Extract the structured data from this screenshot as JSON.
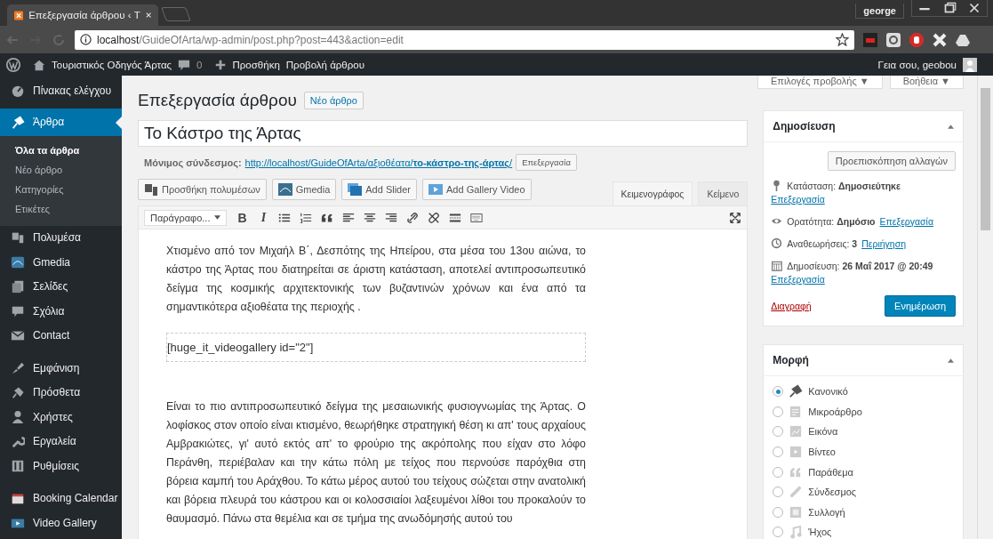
{
  "browser": {
    "tab_title": "Επεξεργασία άρθρου ‹ T",
    "profile": "george",
    "url_host": "localhost",
    "url_path": "/GuideOfArta/wp-admin/post.php?post=443&action=edit"
  },
  "admin_bar": {
    "site_name": "Τουριστικός Οδηγός Άρτας",
    "comments": "0",
    "new": "Προσθήκη",
    "view": "Προβολή άρθρου",
    "greeting": "Γεια σου, geobou"
  },
  "sidebar": {
    "groups": [
      {
        "items": [
          {
            "label": "Πίνακας ελέγχου",
            "selected": false
          },
          {
            "label": "Άρθρα",
            "selected": true,
            "children": [
              {
                "label": "Όλα τα άρθρα",
                "selected": true
              },
              {
                "label": "Νέο άρθρο",
                "selected": false
              },
              {
                "label": "Κατηγορίες",
                "selected": false
              },
              {
                "label": "Ετικέτες",
                "selected": false
              }
            ]
          },
          {
            "label": "Πολυμέσα",
            "selected": false
          },
          {
            "label": "Gmedia",
            "selected": false
          },
          {
            "label": "Σελίδες",
            "selected": false
          },
          {
            "label": "Σχόλια",
            "selected": false
          },
          {
            "label": "Contact",
            "selected": false
          }
        ]
      },
      {
        "items": [
          {
            "label": "Εμφάνιση",
            "selected": false
          },
          {
            "label": "Πρόσθετα",
            "selected": false
          },
          {
            "label": "Χρήστες",
            "selected": false
          },
          {
            "label": "Εργαλεία",
            "selected": false
          },
          {
            "label": "Ρυθμίσεις",
            "selected": false
          }
        ]
      },
      {
        "items": [
          {
            "label": "Booking Calendar",
            "selected": false
          },
          {
            "label": "Video Gallery",
            "selected": false
          }
        ]
      }
    ]
  },
  "screen_tabs": [
    "Επιλογές προβολής ▼",
    "Βοήθεια ▼"
  ],
  "heading": "Επεξεργασία άρθρου",
  "new_post": "Νέο άρθρο",
  "title_field": {
    "value": "Το Κάστρο της Άρτας"
  },
  "permalink": {
    "label": "Μόνιμος σύνδεσμος:",
    "url": "http://localhost/GuideOfArta/αξιοθέατα/**το-κάστρο-της-άρτας**/",
    "edit": "Επεξεργασία"
  },
  "media_buttons": [
    "Προσθήκη πολυμέσων",
    "Gmedia",
    "Add Slider",
    "Add Gallery Video"
  ],
  "editor_tabs": [
    {
      "label": "Κειμενογράφος",
      "selected": true
    },
    {
      "label": "Κείμενο",
      "selected": false
    }
  ],
  "toolbar": {
    "format": "Παράγραφο...",
    "bold": "B",
    "italic": "I"
  },
  "content": [
    {
      "kind": "paragraph",
      "text": "Χτισμένο από τον Μιχαήλ Β΄, Δεσπότης της Ηπείρου, στα μέσα του 13ου αιώνα, το κάστρο της Άρτας που διατηρείται σε άριστη κατάσταση, αποτελεί αντιπροσωπευτικό δείγμα της κοσμικής αρχιτεκτονικής των βυζαντινών χρόνων και ένα από τα σημαντικότερα αξιοθέατα της περιοχής ."
    },
    {
      "kind": "shortcode",
      "text": "[huge_it_videogallery id=\"2\"]"
    },
    {
      "kind": "paragraph",
      "text": "Είναι το πιο αντιπροσωπευτικό δείγμα της μεσαιωνικής φυσιογνωμίας της Άρτας. Ο λοφίσκος στον οποίο είναι κτισμένο, θεωρήθηκε στρατηγική θέση κι απ' τους αρχαίους Αμβρακιώτες, γι' αυτό εκτός απ' το φρούριο της ακρόπολης που είχαν στο λόφο Περάνθη, περιέβαλαν και την κάτω πόλη με τείχος που περνούσε παρόχθια στη βόρεια καμπή του Αράχθου. Το κάτω μέρος αυτού του τείχους σώζεται στην ανατολική και βόρεια πλευρά του κάστρου και οι κολοσσιαίοι λαξευμένοι λίθοι του προκαλούν το θαυμασμό. Πάνω στα θεμέλια και σε τμήμα της ανωδόμησής αυτού του"
    }
  ],
  "publish": {
    "title": "Δημοσίευση",
    "preview": "Προεπισκόπηση αλλαγών",
    "rows": [
      {
        "text": "Κατάσταση: **Δημοσιεύτηκε**",
        "link": "Επεξεργασία"
      },
      {
        "text": "Ορατότητα: **Δημόσιο**",
        "link": "Επεξεργασία"
      },
      {
        "text": "Αναθεωρήσεις: **3**",
        "link": "Περιήγηση"
      },
      {
        "text": "Δημοσίευση: **26 Μαΐ 2017 @ 20:49**",
        "link": "Επεξεργασία"
      }
    ],
    "delete": "Διαγραφή",
    "update": "Ενημέρωση"
  },
  "format": {
    "title": "Μορφή",
    "options": [
      {
        "label": "Κανονικό",
        "selected": true
      },
      {
        "label": "Μικροάρθρο",
        "selected": false
      },
      {
        "label": "Εικόνα",
        "selected": false
      },
      {
        "label": "Βίντεο",
        "selected": false
      },
      {
        "label": "Παράθεμα",
        "selected": false
      },
      {
        "label": "Σύνδεσμος",
        "selected": false
      },
      {
        "label": "Συλλογή",
        "selected": false
      },
      {
        "label": "Ήχος",
        "selected": false
      }
    ]
  }
}
